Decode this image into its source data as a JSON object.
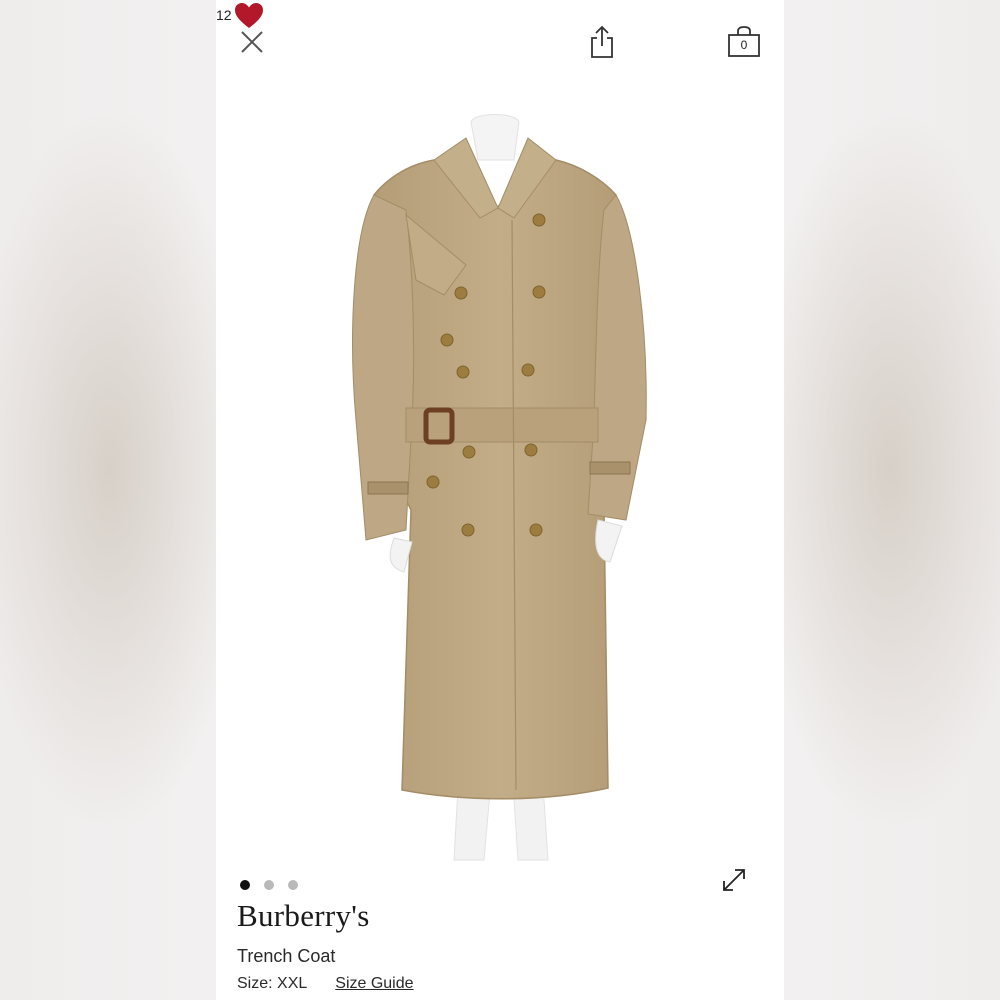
{
  "header": {
    "close_icon": "close-icon",
    "share_icon": "share-icon",
    "like_count": "12",
    "heart_icon": "heart-icon",
    "heart_color": "#b3182a",
    "bag_count": "0",
    "bag_icon": "shopping-bag-icon"
  },
  "gallery": {
    "image_count": 3,
    "active_index": 0,
    "expand_icon": "expand-icon"
  },
  "product": {
    "brand": "Burberry's",
    "name": "Trench Coat",
    "size_label": "Size: XXL",
    "size_guide_label": "Size Guide"
  },
  "colors": {
    "coat": "#bfa983",
    "buttons": "#9c7d3f",
    "buckle": "#6e4023"
  }
}
